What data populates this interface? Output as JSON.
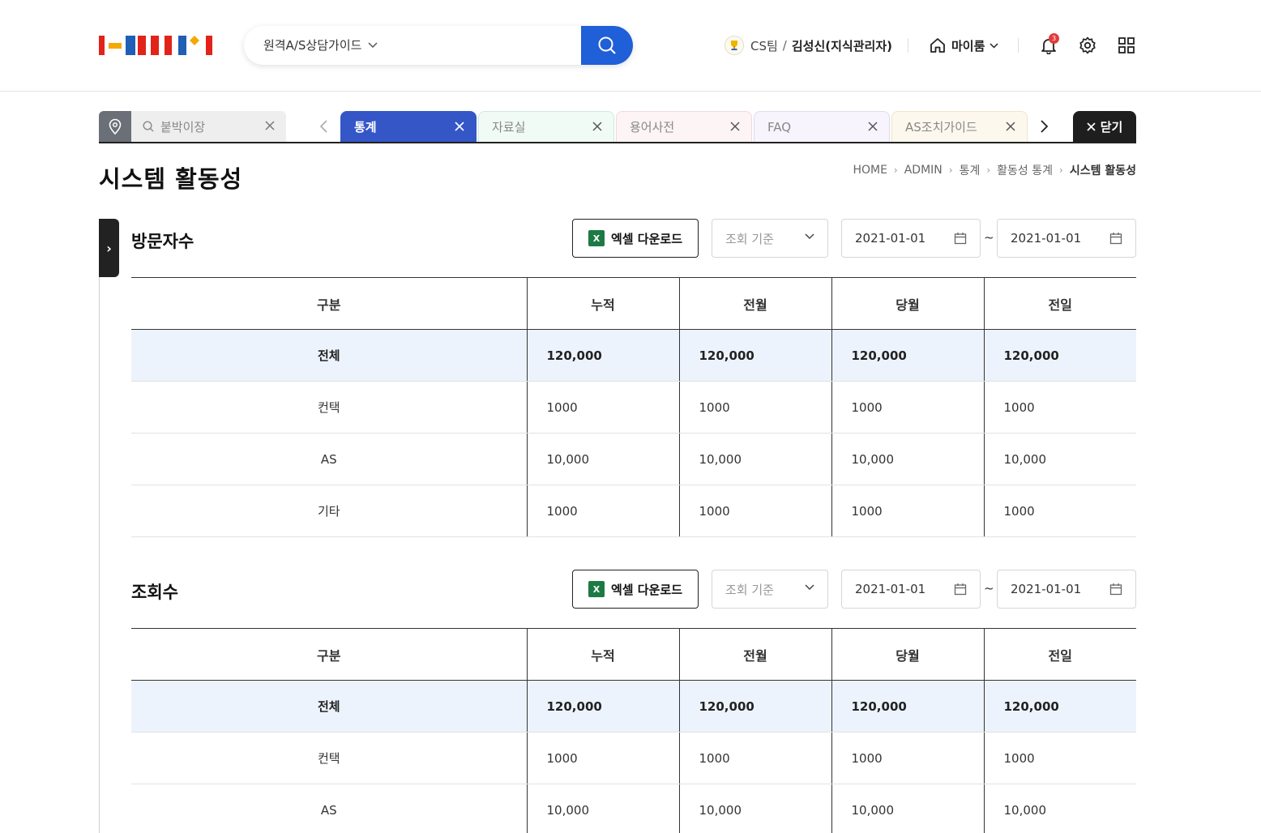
{
  "header": {
    "search": {
      "selected": "원격A/S상담가이드"
    },
    "user": {
      "team": "CS팀",
      "separator": "/",
      "name": "김성신(지식관리자)"
    },
    "myroom_label": "마이룸",
    "notification_count": "3"
  },
  "tabbar": {
    "pinned_search": "붙박이장",
    "tabs": [
      {
        "label": "통계",
        "active": true,
        "color": "#3556c7"
      },
      {
        "label": "자료실",
        "color": "#f1fbf6"
      },
      {
        "label": "용어사전",
        "color": "#fdf4f5"
      },
      {
        "label": "FAQ",
        "color": "#f7f4fd"
      },
      {
        "label": "AS조치가이드",
        "color": "#fdf8ee"
      }
    ],
    "close_label": "닫기"
  },
  "page": {
    "title": "시스템 활동성",
    "breadcrumb": [
      "HOME",
      "ADMIN",
      "통계",
      "활동성 통계",
      "시스템 활동성"
    ]
  },
  "sections": [
    {
      "title": "방문자수",
      "excel_label": "엑셀 다운로드",
      "select_placeholder": "조회 기준",
      "date_from": "2021-01-01",
      "date_sep": "~",
      "date_to": "2021-01-01",
      "columns": [
        "구분",
        "누적",
        "전월",
        "당월",
        "전일"
      ],
      "rows": [
        [
          "전체",
          "120,000",
          "120,000",
          "120,000",
          "120,000"
        ],
        [
          "컨택",
          "1000",
          "1000",
          "1000",
          "1000"
        ],
        [
          "AS",
          "10,000",
          "10,000",
          "10,000",
          "10,000"
        ],
        [
          "기타",
          "1000",
          "1000",
          "1000",
          "1000"
        ]
      ]
    },
    {
      "title": "조회수",
      "excel_label": "엑셀 다운로드",
      "select_placeholder": "조회 기준",
      "date_from": "2021-01-01",
      "date_sep": "~",
      "date_to": "2021-01-01",
      "columns": [
        "구분",
        "누적",
        "전월",
        "당월",
        "전일"
      ],
      "rows": [
        [
          "전체",
          "120,000",
          "120,000",
          "120,000",
          "120,000"
        ],
        [
          "컨택",
          "1000",
          "1000",
          "1000",
          "1000"
        ],
        [
          "AS",
          "10,000",
          "10,000",
          "10,000",
          "10,000"
        ]
      ]
    }
  ]
}
